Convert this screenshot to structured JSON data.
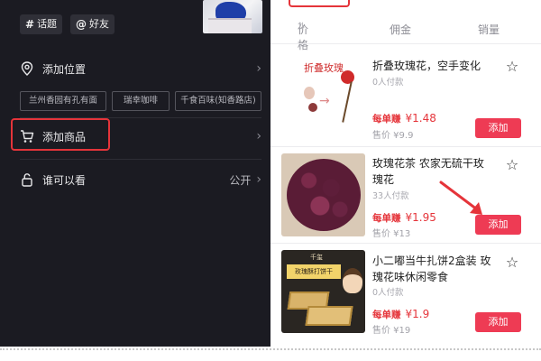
{
  "left_panel": {
    "tags": [
      {
        "symbol": "#",
        "label": "话题"
      },
      {
        "symbol": "@",
        "label": "好友"
      }
    ],
    "add_location": {
      "label": "添加位置"
    },
    "location_suggestions": [
      "兰州香园有孔有面",
      "瑞幸咖啡",
      "千食百味(知香路店)"
    ],
    "add_product": {
      "label": "添加商品"
    },
    "visibility": {
      "label": "谁可以看",
      "value": "公开"
    }
  },
  "right_panel": {
    "columns": [
      "价格",
      "佣金",
      "销量"
    ],
    "sort_icon": "⇅",
    "products": [
      {
        "title": "折叠玫瑰花，空手变化",
        "sold": "0人付款",
        "earn_label": "每单赚",
        "earn_value": "¥1.48",
        "price": "售价 ¥9.9",
        "add_label": "添加",
        "image_text": "折叠玫瑰"
      },
      {
        "title": "玫瑰花茶 农家无硫干玫瑰花",
        "sold": "33人付款",
        "earn_label": "每单赚",
        "earn_value": "¥1.95",
        "price": "售价 ¥13",
        "add_label": "添加"
      },
      {
        "title": "小二嘟当牛扎饼2盒装 玫瑰花味休闲零食",
        "sold": "0人付款",
        "earn_label": "每单赚",
        "earn_value": "¥1.9",
        "price": "售价 ¥19",
        "add_label": "添加",
        "image_text": "千玺",
        "image_banner": "玫瑰酥打饼干"
      }
    ]
  },
  "colors": {
    "accent_red": "#e5343a",
    "add_button": "#ee3b54",
    "dark_bg": "#1b1b22"
  },
  "icons": [
    "hashtag-icon",
    "at-icon",
    "location-pin-icon",
    "cart-icon",
    "lock-icon",
    "chevron-right-icon",
    "star-icon",
    "sort-icon"
  ]
}
